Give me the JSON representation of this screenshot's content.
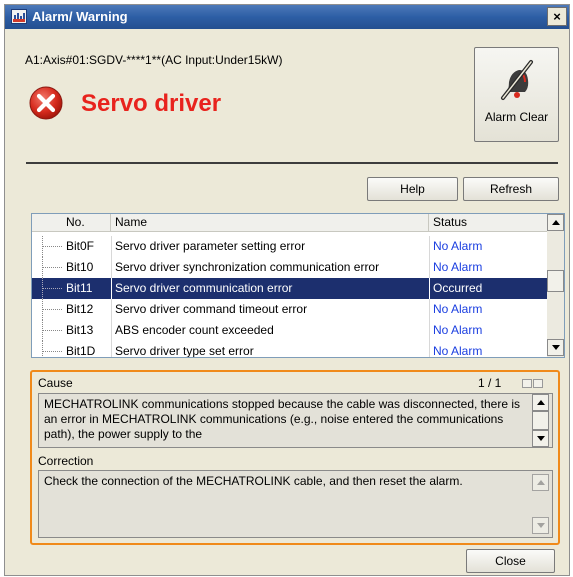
{
  "window": {
    "title": "Alarm/ Warning",
    "close_glyph": "×"
  },
  "device": {
    "text": "A1:Axis#01:SGDV-****1**(AC Input:Under15kW)"
  },
  "header": {
    "title": "Servo driver",
    "title_color": "#e8231d",
    "icon": "error-circle-icon"
  },
  "toolbar": {
    "alarm_clear_label": "Alarm Clear",
    "alarm_clear_icon": "alarm-clear-icon",
    "help_label": "Help",
    "refresh_label": "Refresh"
  },
  "table": {
    "columns": [
      "No.",
      "Name",
      "Status"
    ],
    "rows": [
      {
        "no": "Bit0F",
        "name": "Servo driver parameter setting error",
        "status": "No Alarm"
      },
      {
        "no": "Bit10",
        "name": "Servo driver synchronization communication error",
        "status": "No Alarm"
      },
      {
        "no": "Bit11",
        "name": "Servo driver communication error",
        "status": "Occurred"
      },
      {
        "no": "Bit12",
        "name": "Servo driver command timeout error",
        "status": "No Alarm"
      },
      {
        "no": "Bit13",
        "name": "ABS encoder count exceeded",
        "status": "No Alarm"
      },
      {
        "no": "Bit1D",
        "name": "Servo driver type set error",
        "status": "No Alarm"
      }
    ],
    "selected_row": 2,
    "no_alarm_color": "#1a3ee0",
    "selected_bg": "#1c2f6e"
  },
  "cause": {
    "label": "Cause",
    "page": "1 / 1",
    "text": "MECHATROLINK communications stopped because the cable was disconnected, there is an error in MECHATROLINK communications (e.g., noise entered the communications path), the power supply to the"
  },
  "correction": {
    "label": "Correction",
    "text": "Check the connection of the MECHATROLINK cable, and then reset the alarm."
  },
  "footer": {
    "close_label": "Close"
  },
  "colors": {
    "highlight_border": "#f08a1a",
    "dialog_bg": "#ece9d8"
  }
}
